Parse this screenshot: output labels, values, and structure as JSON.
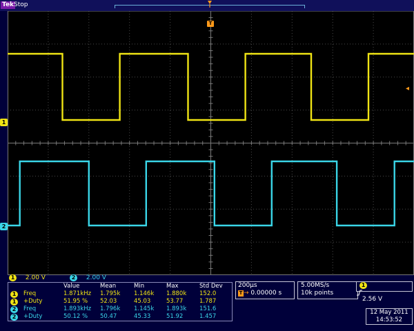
{
  "brand": "Tek",
  "acquisition_state": "Stop",
  "channel_markers": {
    "ch1": "1",
    "ch2": "2",
    "trigger": "T"
  },
  "colors": {
    "ch1": "#f0e414",
    "ch2": "#3ad6e8",
    "trigger": "#ff9a1a",
    "background": "#000000",
    "grid": "#5a5a5a"
  },
  "vertical_scale": {
    "ch1": {
      "badge": "1",
      "value": "2.00 V"
    },
    "ch2": {
      "badge": "2",
      "value": "2.00 V"
    }
  },
  "measurements": {
    "headers": [
      "Value",
      "Mean",
      "Min",
      "Max",
      "Std Dev"
    ],
    "rows": [
      {
        "ch": "1",
        "name": "Freq",
        "value": "1.871kHz",
        "mean": "1.795k",
        "min": "1.146k",
        "max": "1.880k",
        "std": "152.0"
      },
      {
        "ch": "1",
        "name": "+Duty",
        "value": "51.95 %",
        "mean": "52.03",
        "min": "45.03",
        "max": "53.77",
        "std": "1.787"
      },
      {
        "ch": "2",
        "name": "Freq",
        "value": "1.893kHz",
        "mean": "1.796k",
        "min": "1.145k",
        "max": "1.893k",
        "std": "151.6"
      },
      {
        "ch": "2",
        "name": "+Duty",
        "value": "50.12 %",
        "mean": "50.47",
        "min": "45.33",
        "max": "51.92",
        "std": "1.457"
      }
    ]
  },
  "horizontal": {
    "scale": "200µs",
    "position_icon": "T",
    "position": "0.00000 s"
  },
  "acquisition": {
    "sample_rate": "5.00MS/s",
    "record_length": "10k points"
  },
  "trigger": {
    "source": "1",
    "slope_icon": "rising-edge-icon",
    "level": "2.56 V"
  },
  "timestamp": {
    "date": "12 May 2011",
    "time": "14:53:52"
  },
  "waveform_data": {
    "ch1": {
      "transitions_div": [
        1.35,
        2.76,
        4.44,
        5.85,
        7.47,
        8.88
      ],
      "initial_state": "high"
    },
    "ch2": {
      "transitions_div": [
        0.3,
        2.0,
        3.41,
        5.09,
        6.5,
        8.1,
        9.52
      ],
      "initial_state": "low"
    }
  }
}
